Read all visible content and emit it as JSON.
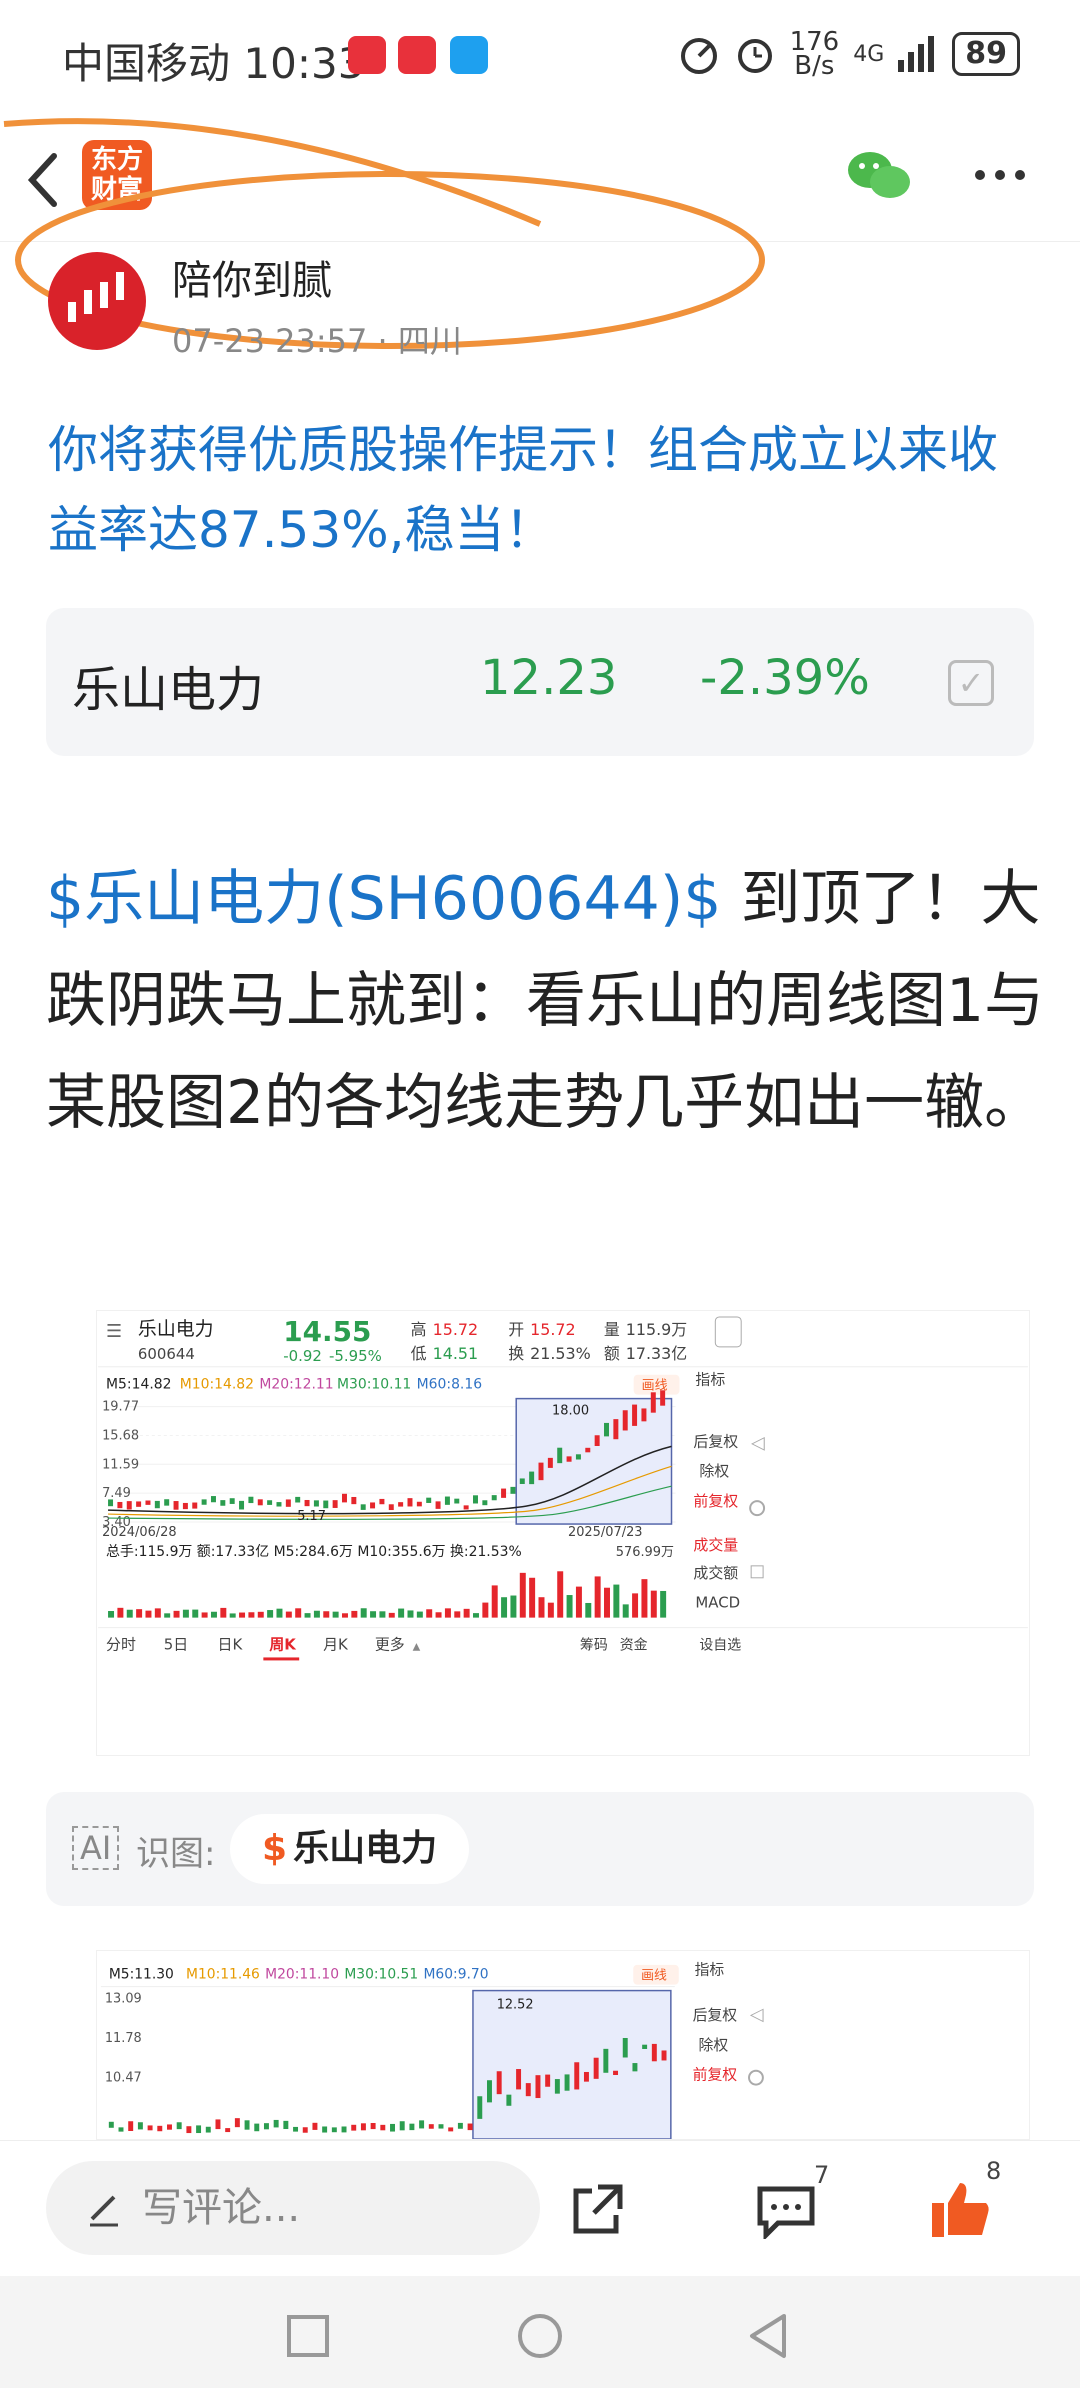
{
  "status_bar": {
    "carrier": "中国移动",
    "time": "10:33",
    "net_speed_value": "176",
    "net_speed_unit": "B/s",
    "signal": "4G",
    "battery": "89"
  },
  "header": {
    "logo_line1": "东方",
    "logo_line2": "财富"
  },
  "author": {
    "name": "陪你到腻",
    "time": "07-23 23:57",
    "separator": "·",
    "location": "四川"
  },
  "post": {
    "title": "你将获得优质股操作提示！组合成立以来收益率达87.53%,稳当！",
    "stock_tag": "$乐山电力(SH600644)$",
    "body_text": " 到顶了！大跌阴跌马上就到：看乐山的周线图1与某股图2的各均线走势几乎如出一辙。"
  },
  "stock_card": {
    "name": "乐山电力",
    "price": "12.23",
    "change": "-2.39%"
  },
  "chart1": {
    "name": "乐山电力",
    "code": "600644",
    "price": "14.55",
    "change": "-0.92",
    "change_pct": "-5.95%",
    "high_label": "高",
    "high": "15.72",
    "low_label": "低",
    "low": "14.51",
    "open_label": "开",
    "open": "15.72",
    "turnover_label": "换",
    "turnover": "21.53%",
    "vol_label": "量",
    "vol": "115.9万",
    "amount_label": "额",
    "amount": "17.33亿",
    "ma": [
      "M5:14.82",
      "M10:14.82",
      "M20:12.11",
      "M30:10.11",
      "M60:8.16"
    ],
    "draw_label": "画线",
    "indicator_label": "指标",
    "y_ticks": [
      "19.77",
      "15.68",
      "11.59",
      "7.49",
      "3.40"
    ],
    "peak": "18.00",
    "low_mark": "5.17",
    "date_start": "2024/06/28",
    "date_end": "2025/07/23",
    "vol_row": "总手:115.9万 额:17.33亿 M5:284.6万 M10:355.6万 换:21.53%",
    "vol_max": "576.99万",
    "side_options": [
      "后复权",
      "除权",
      "前复权",
      "成交量",
      "成交额",
      "MACD"
    ],
    "tabs": [
      "分时",
      "5日",
      "日K",
      "周K",
      "月K",
      "更多"
    ],
    "right_tabs": [
      "筹码",
      "资金",
      "设自选"
    ],
    "chart_data": {
      "type": "candlestick",
      "period": "weekly",
      "y_ticks": [
        19.77,
        15.68,
        11.59,
        7.49,
        3.4
      ],
      "high_marker": 18.0,
      "low_marker": 5.17,
      "x_range": [
        "2024/06/28",
        "2025/07/23"
      ],
      "vol_max": "576.99万"
    }
  },
  "ai_row": {
    "ai_icon": "AI",
    "label": "识图:",
    "tag_symbol": "$",
    "tag": "乐山电力"
  },
  "chart2": {
    "ma": [
      "M5:11.30",
      "M10:11.46",
      "M20:11.10",
      "M30:10.51",
      "M60:9.70"
    ],
    "draw_label": "画线",
    "indicator_label": "指标",
    "y_ticks": [
      "13.09",
      "11.78",
      "10.47"
    ],
    "peak": "12.52",
    "side_options": [
      "后复权",
      "除权",
      "前复权"
    ]
  },
  "bottom": {
    "comment_placeholder": "写评论...",
    "comment_count": "7",
    "like_count": "8"
  }
}
